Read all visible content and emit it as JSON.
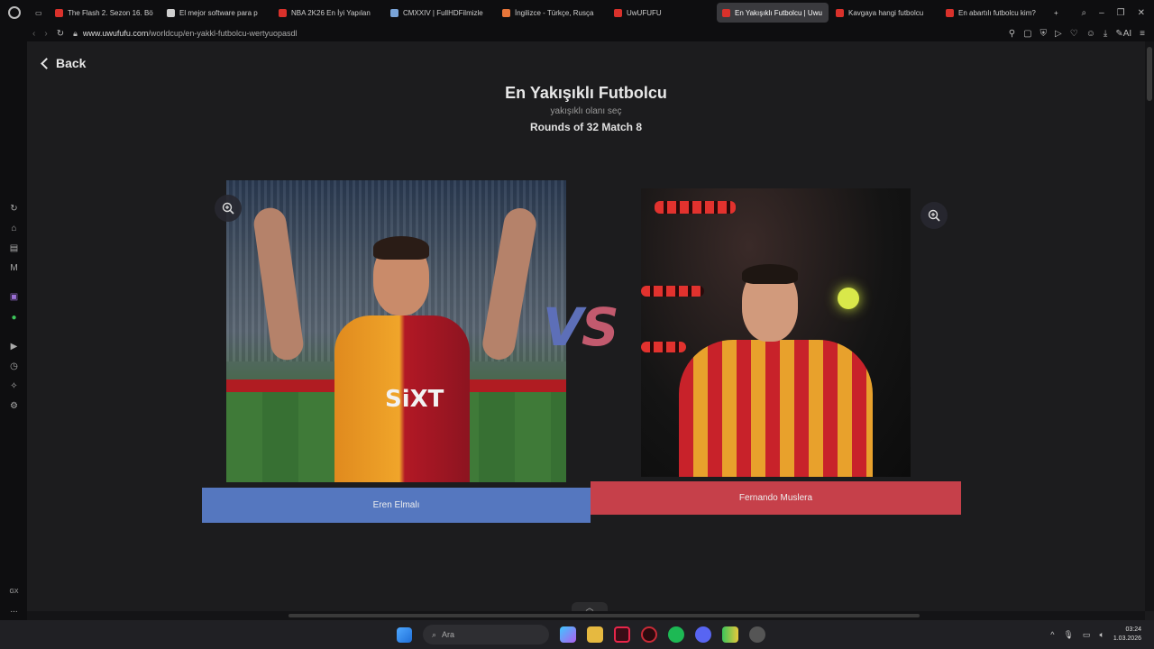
{
  "browser": {
    "tabs": [
      {
        "label": "The Flash 2. Sezon 16. Bö",
        "color": "#d9312b"
      },
      {
        "label": "El mejor software para p",
        "color": "#cfcfcf"
      },
      {
        "label": "NBA 2K26 En İyi Yapılan",
        "color": "#d9312b"
      },
      {
        "label": "CMXXIV | FullHDFilmizle",
        "color": "#7aa4d8"
      },
      {
        "label": "İngilizce - Türkçe, Rusça",
        "color": "#e8763a"
      },
      {
        "label": "UwUFUFU",
        "color": "#d9312b"
      },
      {
        "label": "En Yakışıklı Futbolcu | Uwu",
        "color": "#d9312b",
        "active": true
      },
      {
        "label": "Kavgaya hangi futbolcu",
        "color": "#d9312b"
      },
      {
        "label": "En abartılı futbolcu kim?",
        "color": "#d9312b"
      }
    ],
    "url_host": "www.uwufufu.com",
    "url_path": "/worldcup/en-yakkl-futbolcu-wertyuopasdl"
  },
  "page": {
    "back_label": "Back",
    "title": "En Yakışıklı Futbolcu",
    "subtitle": "yakışıklı olanı seç",
    "round": "Rounds of 32 Match 8",
    "vs_v": "V",
    "vs_s": "S",
    "left_choice": "Eren Elmalı",
    "right_choice": "Fernando Muslera",
    "left_color": "#5577bf",
    "right_color": "#c6404a"
  },
  "taskbar": {
    "search_placeholder": "Ara",
    "time": "03:24",
    "date": "1.03.2026"
  },
  "sidebar": {
    "gx_label": "GX",
    "more_label": "..."
  }
}
